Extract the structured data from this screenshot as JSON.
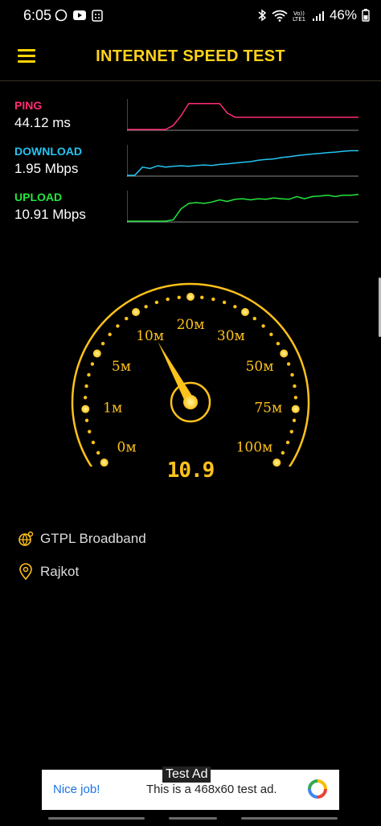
{
  "status": {
    "time": "6:05",
    "battery": "46%",
    "network_label": "VoLTE1"
  },
  "appbar": {
    "title": "INTERNET SPEED TEST"
  },
  "metrics": {
    "ping": {
      "label": "PING",
      "value": "44.12 ms",
      "color": "#ff2d6f"
    },
    "download": {
      "label": "DOWNLOAD",
      "value": "1.95 Mbps",
      "color": "#25c4f2"
    },
    "upload": {
      "label": "UPLOAD",
      "value": "10.91 Mbps",
      "color": "#22e63c"
    }
  },
  "chart_data": [
    {
      "type": "line",
      "series": [
        {
          "name": "PING",
          "values": [
            0.0,
            0.0,
            0.0,
            0.0,
            0.0,
            0.0,
            0.15,
            0.5,
            0.95,
            0.95,
            0.95,
            0.95,
            0.95,
            0.6,
            0.45,
            0.45,
            0.45,
            0.45,
            0.45,
            0.45,
            0.45,
            0.45,
            0.45,
            0.45,
            0.45,
            0.45,
            0.45,
            0.45,
            0.45,
            0.45,
            0.45
          ]
        }
      ]
    },
    {
      "type": "line",
      "series": [
        {
          "name": "DOWNLOAD",
          "values": [
            0.0,
            0.0,
            0.3,
            0.25,
            0.35,
            0.3,
            0.33,
            0.35,
            0.33,
            0.36,
            0.38,
            0.36,
            0.4,
            0.42,
            0.45,
            0.48,
            0.5,
            0.55,
            0.58,
            0.6,
            0.65,
            0.68,
            0.72,
            0.75,
            0.78,
            0.8,
            0.83,
            0.85,
            0.88,
            0.9,
            0.9
          ]
        }
      ]
    },
    {
      "type": "line",
      "series": [
        {
          "name": "UPLOAD",
          "values": [
            0.0,
            0.0,
            0.0,
            0.0,
            0.0,
            0.0,
            0.05,
            0.45,
            0.65,
            0.68,
            0.65,
            0.7,
            0.78,
            0.72,
            0.8,
            0.82,
            0.78,
            0.82,
            0.8,
            0.85,
            0.82,
            0.8,
            0.9,
            0.82,
            0.9,
            0.92,
            0.95,
            0.9,
            0.95,
            0.95,
            0.98
          ]
        }
      ]
    },
    {
      "type": "gauge",
      "scale_labels": [
        "0м",
        "1м",
        "5м",
        "10м",
        "20м",
        "30м",
        "50м",
        "75м",
        "100м"
      ],
      "current_value": 10.9,
      "current_label": "10.9",
      "accent": "#ffc21a"
    }
  ],
  "isp": {
    "provider": "GTPL Broadband",
    "location": "Rajkot"
  },
  "ad": {
    "badge": "Test Ad",
    "headline": "Nice job!",
    "body": "This is a 468x60 test ad."
  }
}
